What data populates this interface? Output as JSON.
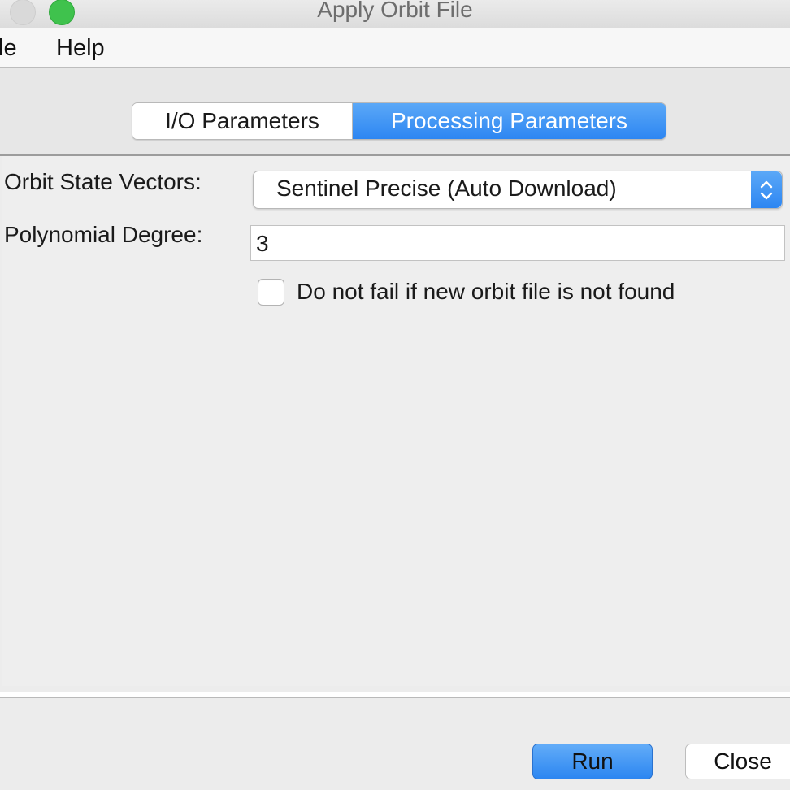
{
  "window": {
    "title": "Apply Orbit File"
  },
  "menubar": {
    "items": [
      {
        "label": "le"
      },
      {
        "label": "Help"
      }
    ]
  },
  "tabs": [
    {
      "label": "I/O Parameters",
      "selected": false
    },
    {
      "label": "Processing Parameters",
      "selected": true
    }
  ],
  "form": {
    "orbit_label": "Orbit State Vectors:",
    "orbit_selected": "Sentinel Precise (Auto Download)",
    "poly_label": "Polynomial Degree:",
    "poly_value": "3",
    "checkbox_label": "Do not fail if new orbit file is not found",
    "checkbox_checked": false
  },
  "buttons": {
    "run": "Run",
    "close": "Close"
  },
  "colors": {
    "accent": "#2d86f2",
    "traffic_green": "#3fc24d"
  }
}
